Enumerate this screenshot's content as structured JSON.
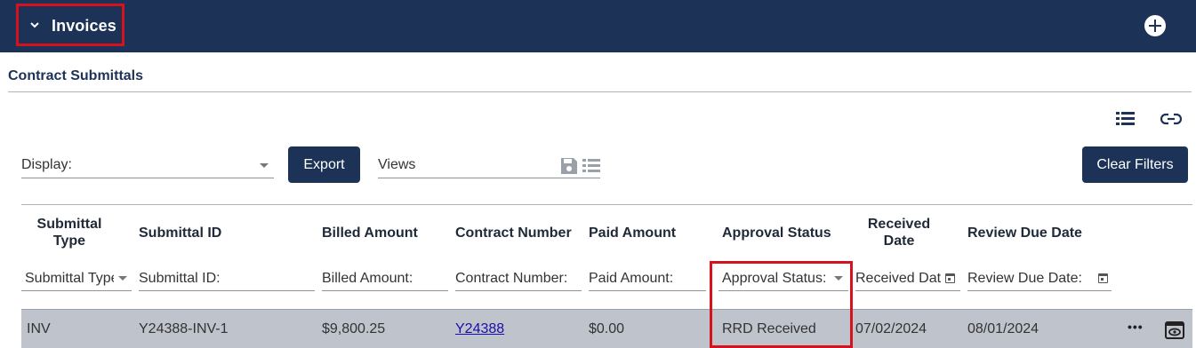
{
  "header": {
    "title": "Invoices",
    "add_icon": "plus-circle-icon"
  },
  "section": {
    "title": "Contract Submittals"
  },
  "toolbar_icons": [
    "list-view-icon",
    "link-icon"
  ],
  "controls": {
    "display_label": "Display:",
    "export_label": "Export",
    "views_label": "Views",
    "clear_filters_label": "Clear Filters"
  },
  "columns": [
    {
      "label": "Submittal Type",
      "filter": "Submittal Type"
    },
    {
      "label": "Submittal ID",
      "filter": "Submittal ID:"
    },
    {
      "label": "Billed Amount",
      "filter": "Billed Amount:"
    },
    {
      "label": "Contract Number",
      "filter": "Contract Number:"
    },
    {
      "label": "Paid Amount",
      "filter": "Paid Amount:"
    },
    {
      "label": "Approval Status",
      "filter": "Approval Status:"
    },
    {
      "label": "Received Date",
      "filter": "Received Date"
    },
    {
      "label": "Review Due Date",
      "filter": "Review Due Date:"
    }
  ],
  "rows": [
    {
      "submittal_type": "INV",
      "submittal_id": "Y24388-INV-1",
      "billed_amount": "$9,800.25",
      "contract_number": "Y24388",
      "paid_amount": "$0.00",
      "approval_status": "RRD Received",
      "received_date": "07/02/2024",
      "review_due_date": "08/01/2024",
      "more": "•••"
    }
  ],
  "colors": {
    "header_bg": "#1c3256",
    "highlight": "#d6131c",
    "row_bg": "#bfc3cc"
  }
}
